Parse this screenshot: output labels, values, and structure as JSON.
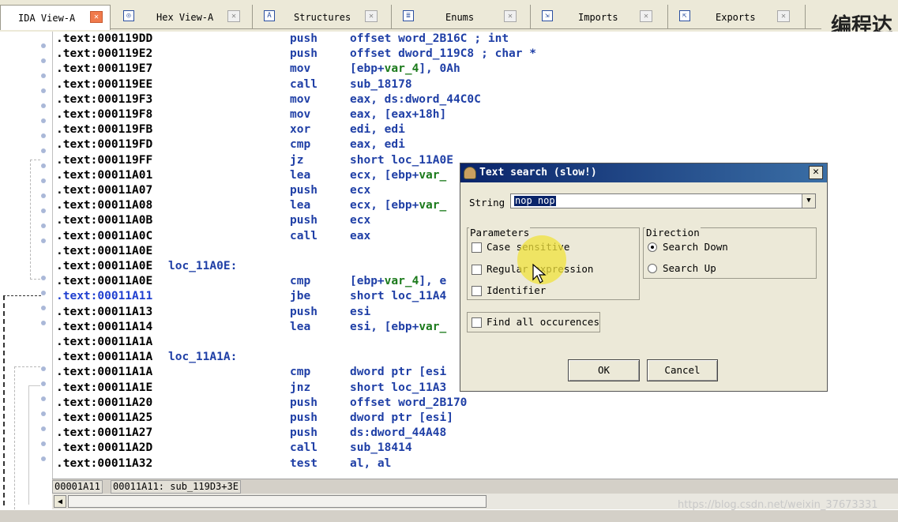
{
  "tabs": [
    {
      "label": "IDA View-A",
      "icon": "ida-view-icon",
      "active": true
    },
    {
      "label": "Hex View-A",
      "icon": "hex-view-icon",
      "active": false
    },
    {
      "label": "Structures",
      "icon": "structures-icon",
      "active": false
    },
    {
      "label": "Enums",
      "icon": "enums-icon",
      "active": false
    },
    {
      "label": "Imports",
      "icon": "imports-icon",
      "active": false
    },
    {
      "label": "Exports",
      "icon": "exports-icon",
      "active": false
    }
  ],
  "overlay_text": "编程达",
  "listing": [
    {
      "addr": ".text:000119DD",
      "label": "",
      "mnemonic": "push",
      "operand": "offset word_2B16C",
      "comment": "; int"
    },
    {
      "addr": ".text:000119E2",
      "label": "",
      "mnemonic": "push",
      "operand": "offset dword_119C8",
      "comment": "; char *"
    },
    {
      "addr": ".text:000119E7",
      "label": "",
      "mnemonic": "mov",
      "operand": "[ebp+var_4], 0Ah",
      "comment": ""
    },
    {
      "addr": ".text:000119EE",
      "label": "",
      "mnemonic": "call",
      "operand": "sub_18178",
      "comment": ""
    },
    {
      "addr": ".text:000119F3",
      "label": "",
      "mnemonic": "mov",
      "operand": "eax, ds:dword_44C0C",
      "comment": ""
    },
    {
      "addr": ".text:000119F8",
      "label": "",
      "mnemonic": "mov",
      "operand": "eax, [eax+18h]",
      "comment": ""
    },
    {
      "addr": ".text:000119FB",
      "label": "",
      "mnemonic": "xor",
      "operand": "edi, edi",
      "comment": ""
    },
    {
      "addr": ".text:000119FD",
      "label": "",
      "mnemonic": "cmp",
      "operand": "eax, edi",
      "comment": ""
    },
    {
      "addr": ".text:000119FF",
      "label": "",
      "mnemonic": "jz",
      "operand": "short loc_11A0E",
      "comment": ""
    },
    {
      "addr": ".text:00011A01",
      "label": "",
      "mnemonic": "lea",
      "operand": "ecx, [ebp+var_",
      "comment": ""
    },
    {
      "addr": ".text:00011A07",
      "label": "",
      "mnemonic": "push",
      "operand": "ecx",
      "comment": ""
    },
    {
      "addr": ".text:00011A08",
      "label": "",
      "mnemonic": "lea",
      "operand": "ecx, [ebp+var_",
      "comment": ""
    },
    {
      "addr": ".text:00011A0B",
      "label": "",
      "mnemonic": "push",
      "operand": "ecx",
      "comment": ""
    },
    {
      "addr": ".text:00011A0C",
      "label": "",
      "mnemonic": "call",
      "operand": "eax",
      "comment": ""
    },
    {
      "addr": ".text:00011A0E",
      "label": "",
      "mnemonic": "",
      "operand": "",
      "comment": ""
    },
    {
      "addr": ".text:00011A0E",
      "label": "loc_11A0E:",
      "mnemonic": "",
      "operand": "",
      "comment": ""
    },
    {
      "addr": ".text:00011A0E",
      "label": "",
      "mnemonic": "cmp",
      "operand": "[ebp+var_4], e",
      "comment": ""
    },
    {
      "addr": ".text:00011A11",
      "label": "",
      "mnemonic": "jbe",
      "operand": "short loc_11A4",
      "comment": "",
      "current": true
    },
    {
      "addr": ".text:00011A13",
      "label": "",
      "mnemonic": "push",
      "operand": "esi",
      "comment": ""
    },
    {
      "addr": ".text:00011A14",
      "label": "",
      "mnemonic": "lea",
      "operand": "esi, [ebp+var_",
      "comment": ""
    },
    {
      "addr": ".text:00011A1A",
      "label": "",
      "mnemonic": "",
      "operand": "",
      "comment": ""
    },
    {
      "addr": ".text:00011A1A",
      "label": "loc_11A1A:",
      "mnemonic": "",
      "operand": "",
      "comment": ""
    },
    {
      "addr": ".text:00011A1A",
      "label": "",
      "mnemonic": "cmp",
      "operand": "dword ptr [esi",
      "comment": ""
    },
    {
      "addr": ".text:00011A1E",
      "label": "",
      "mnemonic": "jnz",
      "operand": "short loc_11A3",
      "comment": ""
    },
    {
      "addr": ".text:00011A20",
      "label": "",
      "mnemonic": "push",
      "operand": "offset word_2B170",
      "comment": ""
    },
    {
      "addr": ".text:00011A25",
      "label": "",
      "mnemonic": "push",
      "operand": "dword ptr [esi]",
      "comment": ""
    },
    {
      "addr": ".text:00011A27",
      "label": "",
      "mnemonic": "push",
      "operand": "ds:dword_44A48",
      "comment": ""
    },
    {
      "addr": ".text:00011A2D",
      "label": "",
      "mnemonic": "call",
      "operand": "sub_18414",
      "comment": ""
    },
    {
      "addr": ".text:00011A32",
      "label": "",
      "mnemonic": "test",
      "operand": "al, al",
      "comment": ""
    }
  ],
  "status": {
    "offset": "00001A11",
    "location": "00011A11: sub_119D3+3E"
  },
  "watermark": "https://blog.csdn.net/weixin_37673331",
  "dialog": {
    "title": "Text search (slow!)",
    "close_label": "✕",
    "string_label": "String",
    "string_value": "nop nop",
    "parameters_title": "Parameters",
    "parameters": [
      {
        "label": "Case sensitive",
        "checked": false
      },
      {
        "label": "Regular expression",
        "checked": false
      },
      {
        "label": "Identifier",
        "checked": false
      }
    ],
    "direction_title": "Direction",
    "directions": [
      {
        "label": "Search Down",
        "selected": true
      },
      {
        "label": "Search Up",
        "selected": false
      }
    ],
    "find_all_label": "Find all occurences",
    "find_all_checked": false,
    "ok_label": "OK",
    "cancel_label": "Cancel"
  },
  "colors": {
    "code_blue": "#1f3fa6",
    "var_green": "#1b7a1b",
    "title_bar": "#0a246a",
    "active_tab_close": "#f07a4c"
  }
}
